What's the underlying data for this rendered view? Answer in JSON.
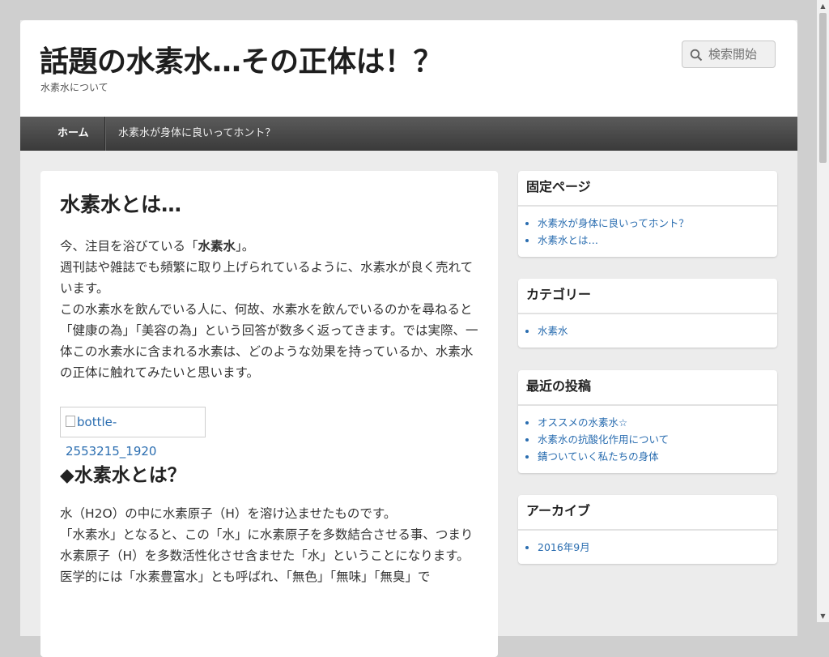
{
  "header": {
    "site_title": "話題の水素水…その正体は！？",
    "site_description": "水素水について",
    "search_placeholder": "検索開始"
  },
  "nav": {
    "home": "ホーム",
    "item2": "水素水が身体に良いってホント？"
  },
  "article": {
    "title": "水素水とは…",
    "p1_prefix": "今、注目を浴びている「",
    "p1_bold": "水素水",
    "p1_suffix": "」。",
    "p2": "週刊誌や雑誌でも頻繁に取り上げられているように、水素水が良く売れています。",
    "p3": "この水素水を飲んでいる人に、何故、水素水を飲んでいるのかを尋ねると「健康の為」「美容の為」という回答が数多く返ってきます。では実際、一体この水素水に含まれる水素は、どのような効果を持っているか、水素水の正体に触れてみたいと思います。",
    "image_alt": "bottle-2553215_1920",
    "h2": "◆水素水とは？",
    "p4": "水（H2O）の中に水素原子（H）を溶け込ませたものです。",
    "p5": "「水素水」となると、この「水」に水素原子を多数結合させる事、つまり",
    "p6": "水素原子（H）を多数活性化させ含ませた「水」ということになります。",
    "p7": "医学的には「水素豊富水」とも呼ばれ、「無色」「無味」「無臭」で"
  },
  "sidebar": {
    "fixed_pages": {
      "title": "固定ページ",
      "items": [
        "水素水が身体に良いってホント？",
        "水素水とは…"
      ]
    },
    "categories": {
      "title": "カテゴリー",
      "items": [
        "水素水"
      ]
    },
    "recent": {
      "title": "最近の投稿",
      "items": [
        "オススメの水素水☆",
        "水素水の抗酸化作用について",
        "錆ついていく私たちの身体"
      ]
    },
    "archives": {
      "title": "アーカイブ",
      "items": [
        "2016年9月"
      ]
    }
  },
  "colors": {
    "link": "#2a6db0",
    "nav_bg": "#4a4a4a"
  }
}
